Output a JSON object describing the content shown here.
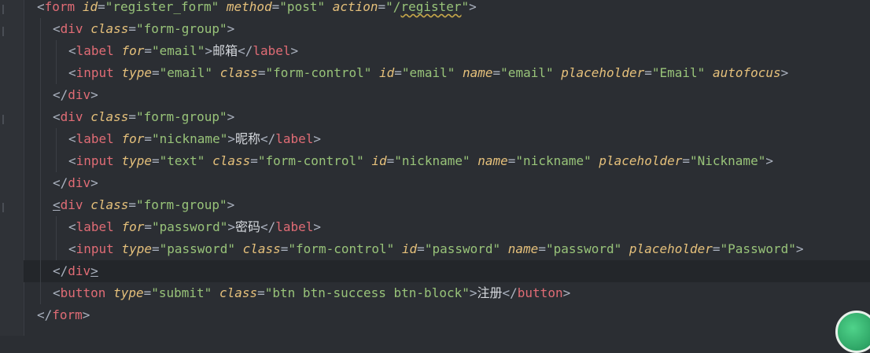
{
  "editor": {
    "lines": [
      [
        {
          "t": "<",
          "c": "punct"
        },
        {
          "t": "form",
          "c": "tag"
        },
        {
          "t": " "
        },
        {
          "t": "id",
          "c": "attr"
        },
        {
          "t": "=",
          "c": "punct"
        },
        {
          "t": "\"register_form\"",
          "c": "str"
        },
        {
          "t": " "
        },
        {
          "t": "method",
          "c": "attr"
        },
        {
          "t": "=",
          "c": "punct"
        },
        {
          "t": "\"post\"",
          "c": "str"
        },
        {
          "t": " "
        },
        {
          "t": "action",
          "c": "attr"
        },
        {
          "t": "=",
          "c": "punct"
        },
        {
          "t": "\"/",
          "c": "str"
        },
        {
          "t": "register",
          "c": "str squiggle"
        },
        {
          "t": "\"",
          "c": "str"
        },
        {
          "t": ">",
          "c": "punct"
        }
      ],
      [
        {
          "t": "<",
          "c": "punct"
        },
        {
          "t": "div",
          "c": "tag"
        },
        {
          "t": " "
        },
        {
          "t": "class",
          "c": "attr"
        },
        {
          "t": "=",
          "c": "punct"
        },
        {
          "t": "\"form-group\"",
          "c": "str"
        },
        {
          "t": ">",
          "c": "punct"
        }
      ],
      [
        {
          "t": "<",
          "c": "punct"
        },
        {
          "t": "label",
          "c": "tag"
        },
        {
          "t": " "
        },
        {
          "t": "for",
          "c": "attr"
        },
        {
          "t": "=",
          "c": "punct"
        },
        {
          "t": "\"email\"",
          "c": "str"
        },
        {
          "t": ">",
          "c": "punct"
        },
        {
          "t": "邮箱",
          "c": "text"
        },
        {
          "t": "</",
          "c": "punct"
        },
        {
          "t": "label",
          "c": "tag"
        },
        {
          "t": ">",
          "c": "punct"
        }
      ],
      [
        {
          "t": "<",
          "c": "punct"
        },
        {
          "t": "input",
          "c": "tag"
        },
        {
          "t": " "
        },
        {
          "t": "type",
          "c": "attr"
        },
        {
          "t": "=",
          "c": "punct"
        },
        {
          "t": "\"email\"",
          "c": "str"
        },
        {
          "t": " "
        },
        {
          "t": "class",
          "c": "attr"
        },
        {
          "t": "=",
          "c": "punct"
        },
        {
          "t": "\"form-control\"",
          "c": "str"
        },
        {
          "t": " "
        },
        {
          "t": "id",
          "c": "attr"
        },
        {
          "t": "=",
          "c": "punct"
        },
        {
          "t": "\"email\"",
          "c": "str"
        },
        {
          "t": " "
        },
        {
          "t": "name",
          "c": "attr"
        },
        {
          "t": "=",
          "c": "punct"
        },
        {
          "t": "\"email\"",
          "c": "str"
        },
        {
          "t": " "
        },
        {
          "t": "placeholder",
          "c": "attr"
        },
        {
          "t": "=",
          "c": "punct"
        },
        {
          "t": "\"Email\"",
          "c": "str"
        },
        {
          "t": " "
        },
        {
          "t": "autofocus",
          "c": "attr"
        },
        {
          "t": ">",
          "c": "punct"
        }
      ],
      [
        {
          "t": "</",
          "c": "punct"
        },
        {
          "t": "div",
          "c": "tag"
        },
        {
          "t": ">",
          "c": "punct"
        }
      ],
      [
        {
          "t": "<",
          "c": "punct"
        },
        {
          "t": "div",
          "c": "tag"
        },
        {
          "t": " "
        },
        {
          "t": "class",
          "c": "attr"
        },
        {
          "t": "=",
          "c": "punct"
        },
        {
          "t": "\"form-group\"",
          "c": "str"
        },
        {
          "t": ">",
          "c": "punct"
        }
      ],
      [
        {
          "t": "<",
          "c": "punct"
        },
        {
          "t": "label",
          "c": "tag"
        },
        {
          "t": " "
        },
        {
          "t": "for",
          "c": "attr"
        },
        {
          "t": "=",
          "c": "punct"
        },
        {
          "t": "\"nickname\"",
          "c": "str"
        },
        {
          "t": ">",
          "c": "punct"
        },
        {
          "t": "昵称",
          "c": "text"
        },
        {
          "t": "</",
          "c": "punct"
        },
        {
          "t": "label",
          "c": "tag"
        },
        {
          "t": ">",
          "c": "punct"
        }
      ],
      [
        {
          "t": "<",
          "c": "punct"
        },
        {
          "t": "input",
          "c": "tag"
        },
        {
          "t": " "
        },
        {
          "t": "type",
          "c": "attr"
        },
        {
          "t": "=",
          "c": "punct"
        },
        {
          "t": "\"text\"",
          "c": "str"
        },
        {
          "t": " "
        },
        {
          "t": "class",
          "c": "attr"
        },
        {
          "t": "=",
          "c": "punct"
        },
        {
          "t": "\"form-control\"",
          "c": "str"
        },
        {
          "t": " "
        },
        {
          "t": "id",
          "c": "attr"
        },
        {
          "t": "=",
          "c": "punct"
        },
        {
          "t": "\"nickname\"",
          "c": "str"
        },
        {
          "t": " "
        },
        {
          "t": "name",
          "c": "attr"
        },
        {
          "t": "=",
          "c": "punct"
        },
        {
          "t": "\"nickname\"",
          "c": "str"
        },
        {
          "t": " "
        },
        {
          "t": "placeholder",
          "c": "attr"
        },
        {
          "t": "=",
          "c": "punct"
        },
        {
          "t": "\"Nickname\"",
          "c": "str"
        },
        {
          "t": ">",
          "c": "punct"
        }
      ],
      [
        {
          "t": "</",
          "c": "punct"
        },
        {
          "t": "div",
          "c": "tag"
        },
        {
          "t": ">",
          "c": "punct"
        }
      ],
      [
        {
          "t": "<",
          "c": "punct ul"
        },
        {
          "t": "div",
          "c": "tag"
        },
        {
          "t": " "
        },
        {
          "t": "class",
          "c": "attr"
        },
        {
          "t": "=",
          "c": "punct"
        },
        {
          "t": "\"form-group\"",
          "c": "str"
        },
        {
          "t": ">",
          "c": "punct"
        }
      ],
      [
        {
          "t": "<",
          "c": "punct"
        },
        {
          "t": "label",
          "c": "tag"
        },
        {
          "t": " "
        },
        {
          "t": "for",
          "c": "attr"
        },
        {
          "t": "=",
          "c": "punct"
        },
        {
          "t": "\"password\"",
          "c": "str"
        },
        {
          "t": ">",
          "c": "punct"
        },
        {
          "t": "密码",
          "c": "text"
        },
        {
          "t": "</",
          "c": "punct"
        },
        {
          "t": "label",
          "c": "tag"
        },
        {
          "t": ">",
          "c": "punct"
        }
      ],
      [
        {
          "t": "<",
          "c": "punct"
        },
        {
          "t": "input",
          "c": "tag"
        },
        {
          "t": " "
        },
        {
          "t": "type",
          "c": "attr"
        },
        {
          "t": "=",
          "c": "punct"
        },
        {
          "t": "\"password\"",
          "c": "str"
        },
        {
          "t": " "
        },
        {
          "t": "class",
          "c": "attr"
        },
        {
          "t": "=",
          "c": "punct"
        },
        {
          "t": "\"form-control\"",
          "c": "str"
        },
        {
          "t": " "
        },
        {
          "t": "id",
          "c": "attr"
        },
        {
          "t": "=",
          "c": "punct"
        },
        {
          "t": "\"password\"",
          "c": "str"
        },
        {
          "t": " "
        },
        {
          "t": "name",
          "c": "attr"
        },
        {
          "t": "=",
          "c": "punct"
        },
        {
          "t": "\"password\"",
          "c": "str"
        },
        {
          "t": " "
        },
        {
          "t": "placeholder",
          "c": "attr"
        },
        {
          "t": "=",
          "c": "punct"
        },
        {
          "t": "\"Password\"",
          "c": "str"
        },
        {
          "t": ">",
          "c": "punct"
        }
      ],
      [
        {
          "t": "</",
          "c": "punct"
        },
        {
          "t": "div",
          "c": "tag"
        },
        {
          "t": ">",
          "c": "punct ul"
        }
      ],
      [
        {
          "t": "<",
          "c": "punct"
        },
        {
          "t": "button",
          "c": "tag"
        },
        {
          "t": " "
        },
        {
          "t": "type",
          "c": "attr"
        },
        {
          "t": "=",
          "c": "punct"
        },
        {
          "t": "\"submit\"",
          "c": "str"
        },
        {
          "t": " "
        },
        {
          "t": "class",
          "c": "attr"
        },
        {
          "t": "=",
          "c": "punct"
        },
        {
          "t": "\"btn btn-success btn-block\"",
          "c": "str"
        },
        {
          "t": ">",
          "c": "punct"
        },
        {
          "t": "注册",
          "c": "text"
        },
        {
          "t": "</",
          "c": "punct"
        },
        {
          "t": "button",
          "c": "tag"
        },
        {
          "t": ">",
          "c": "punct"
        }
      ],
      [
        {
          "t": "</",
          "c": "punct"
        },
        {
          "t": "form",
          "c": "tag"
        },
        {
          "t": ">",
          "c": "punct"
        }
      ]
    ],
    "indents": [
      0,
      1,
      2,
      2,
      1,
      1,
      2,
      2,
      1,
      1,
      2,
      2,
      1,
      1,
      0
    ],
    "current_line": 12
  },
  "colors": {
    "background": "#2b2e33",
    "tag": "#e06c75",
    "attribute": "#e5c07b",
    "string": "#98c379",
    "text": "#d6d9de"
  }
}
